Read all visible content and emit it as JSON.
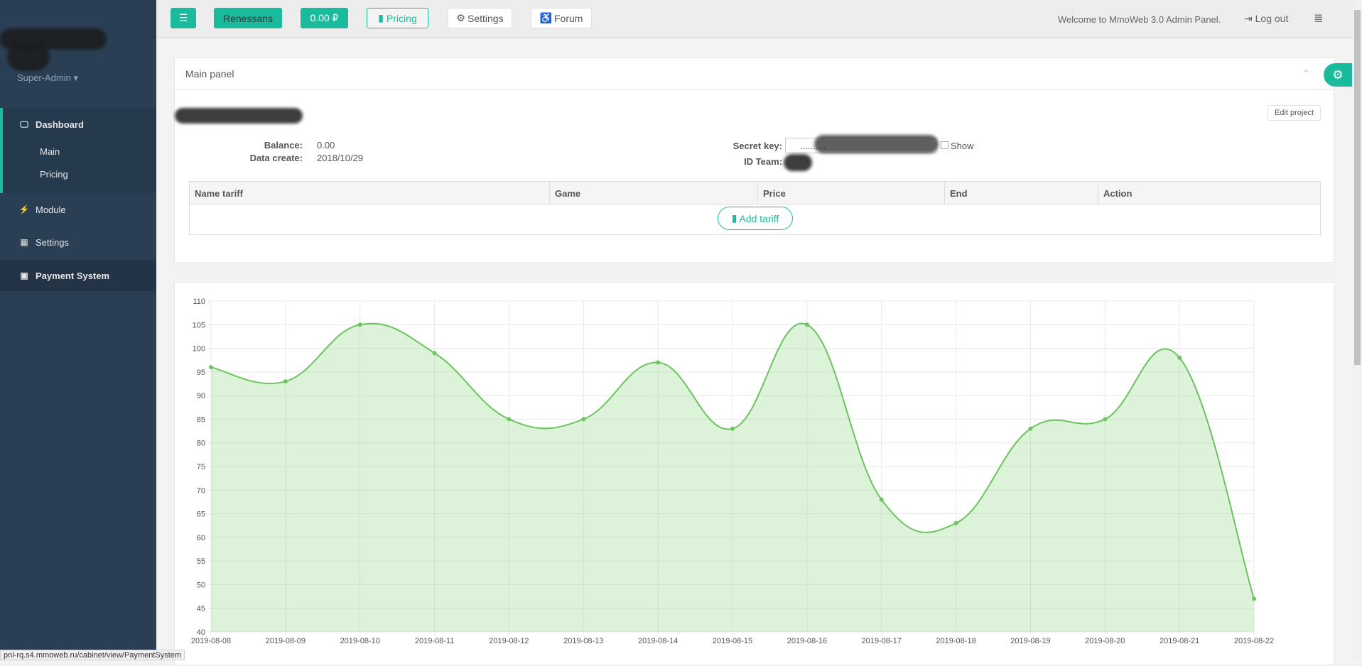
{
  "sidebar": {
    "user": "Super-Admin",
    "items": [
      {
        "label": "Dashboard",
        "icon": "monitor-icon"
      },
      {
        "label": "Main"
      },
      {
        "label": "Pricing"
      },
      {
        "label": "Module",
        "icon": "plug-icon"
      },
      {
        "label": "Settings",
        "icon": "grid-icon"
      },
      {
        "label": "Payment System",
        "icon": "money-icon"
      }
    ]
  },
  "topbar": {
    "project": "Renessans",
    "balance": "0.00 ₽",
    "pricing": "Pricing",
    "settings": "Settings",
    "forum": "Forum",
    "welcome": "Welcome to MmoWeb 3.0 Admin Panel.",
    "logout": "Log out"
  },
  "panel": {
    "title": "Main panel",
    "edit": "Edit project",
    "balance_label": "Balance:",
    "balance": "0.00",
    "date_label": "Data create:",
    "date": "2018/10/29",
    "secret_label": "Secret key:",
    "secret": "..........",
    "show": "Show",
    "team_label": "ID Team:",
    "columns": [
      "Name tariff",
      "Game",
      "Price",
      "End",
      "Action"
    ],
    "add_tariff": "Add tariff"
  },
  "status_url": "pnl-rq.s4.mmoweb.ru/cabinet/view/PaymentSystem",
  "colors": {
    "accent": "#1abb9c",
    "sidebar": "#2a3f54",
    "line": "#6cc35f"
  },
  "chart_data": {
    "type": "area",
    "categories": [
      "2019-08-08",
      "2019-08-09",
      "2019-08-10",
      "2019-08-11",
      "2019-08-12",
      "2019-08-13",
      "2019-08-14",
      "2019-08-15",
      "2019-08-16",
      "2019-08-17",
      "2019-08-18",
      "2019-08-19",
      "2019-08-20",
      "2019-08-21",
      "2019-08-22"
    ],
    "values": [
      96,
      93,
      105,
      99,
      85,
      85,
      97,
      83,
      105,
      68,
      63,
      83,
      85,
      98,
      47
    ],
    "ylim": [
      40,
      110
    ],
    "yticks": [
      40,
      45,
      50,
      55,
      60,
      65,
      70,
      75,
      80,
      85,
      90,
      95,
      100,
      105,
      110
    ],
    "grid": true
  }
}
